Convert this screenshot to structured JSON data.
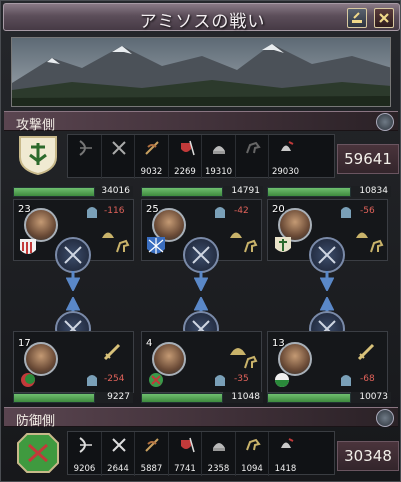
{
  "window": {
    "title": "アミソスの戦い"
  },
  "attacker": {
    "label": "攻撃側",
    "units": [
      {
        "icon": "archer-icon",
        "count": ""
      },
      {
        "icon": "heavy-infantry-icon",
        "count": ""
      },
      {
        "icon": "light-cavalry-icon",
        "count": "9032"
      },
      {
        "icon": "pikeman-icon",
        "count": "2269"
      },
      {
        "icon": "light-infantry-icon",
        "count": "19310"
      },
      {
        "icon": "horse-archer-icon",
        "count": ""
      },
      {
        "icon": "heavy-cavalry-icon",
        "count": "29030"
      }
    ],
    "total": "59641",
    "flanks": [
      {
        "strength": "34016",
        "level": "23",
        "delta": "-116"
      },
      {
        "strength": "14791",
        "level": "25",
        "delta": "-42"
      },
      {
        "strength": "10834",
        "level": "20",
        "delta": "-56"
      }
    ]
  },
  "defender": {
    "label": "防御側",
    "units": [
      {
        "icon": "archer-icon",
        "count": "9206"
      },
      {
        "icon": "heavy-infantry-icon",
        "count": "2644"
      },
      {
        "icon": "light-cavalry-icon",
        "count": "5887"
      },
      {
        "icon": "pikeman-icon",
        "count": "7741"
      },
      {
        "icon": "light-infantry-icon",
        "count": "2358"
      },
      {
        "icon": "horse-archer-icon",
        "count": "1094"
      },
      {
        "icon": "heavy-cavalry-icon",
        "count": "1418"
      }
    ],
    "total": "30348",
    "flanks": [
      {
        "strength": "9227",
        "level": "17",
        "delta": "-254"
      },
      {
        "strength": "11048",
        "level": "4",
        "delta": "-35"
      },
      {
        "strength": "10073",
        "level": "13",
        "delta": "-68"
      }
    ]
  },
  "colors": {
    "health": "#4f9e4f",
    "loss": "#e0625a",
    "title_bg": "#5c4e5a"
  }
}
